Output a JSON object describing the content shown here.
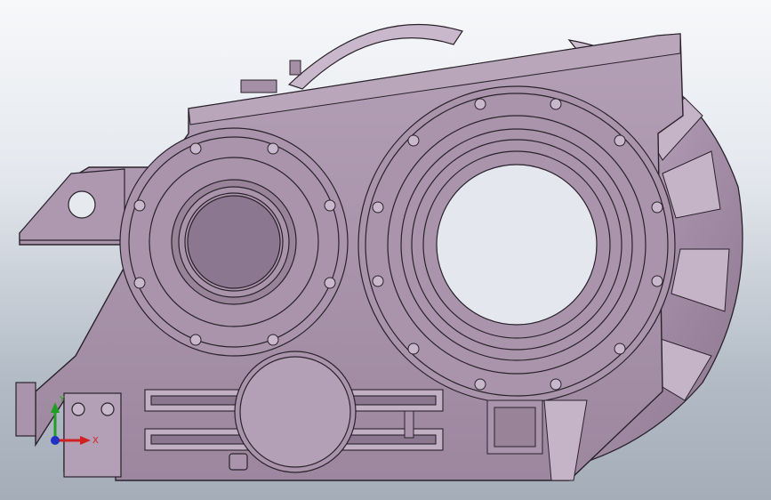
{
  "viewport": {
    "background_top": "#f7f8fa",
    "background_bottom": "#a4adb8"
  },
  "model": {
    "body_color": "#a48fa6",
    "shade_color": "#8c7790",
    "highlight_color": "#d6c8d8",
    "edge_color": "#2a222b"
  },
  "triad": {
    "x_label": "X",
    "y_label": "Y",
    "x_color": "#d22020",
    "y_color": "#1fa11f",
    "z_color": "#2030c8"
  }
}
